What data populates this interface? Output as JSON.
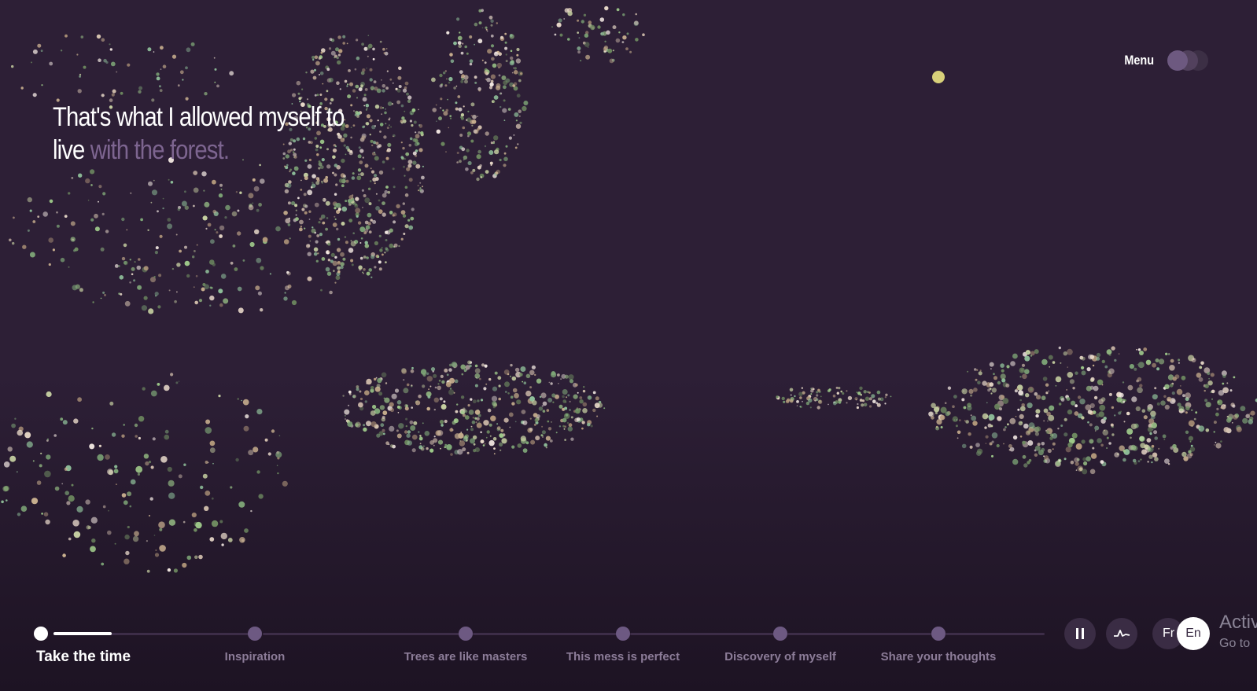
{
  "headline": {
    "lit": "That's what I allowed myself to live",
    "dim": " with the forest."
  },
  "menu": {
    "label": "Menu"
  },
  "timeline": {
    "progress": 0.35,
    "chapters": [
      {
        "label": "Take the time",
        "active": true
      },
      {
        "label": "Inspiration",
        "active": false
      },
      {
        "label": "Trees are like masters",
        "active": false
      },
      {
        "label": "This mess is perfect",
        "active": false
      },
      {
        "label": "Discovery of myself",
        "active": false
      },
      {
        "label": "Share your thoughts",
        "active": false
      }
    ]
  },
  "controls": {
    "pause_icon": "pause-icon",
    "sound_icon": "waveform-icon"
  },
  "language": {
    "fr": "Fr",
    "en": "En",
    "selected": "En"
  },
  "watermark": {
    "line1": "Activ",
    "line2": "Go to"
  },
  "colors": {
    "background": "#2d1f36",
    "accent_dim": "#7d6590",
    "node": "#6d5982"
  }
}
